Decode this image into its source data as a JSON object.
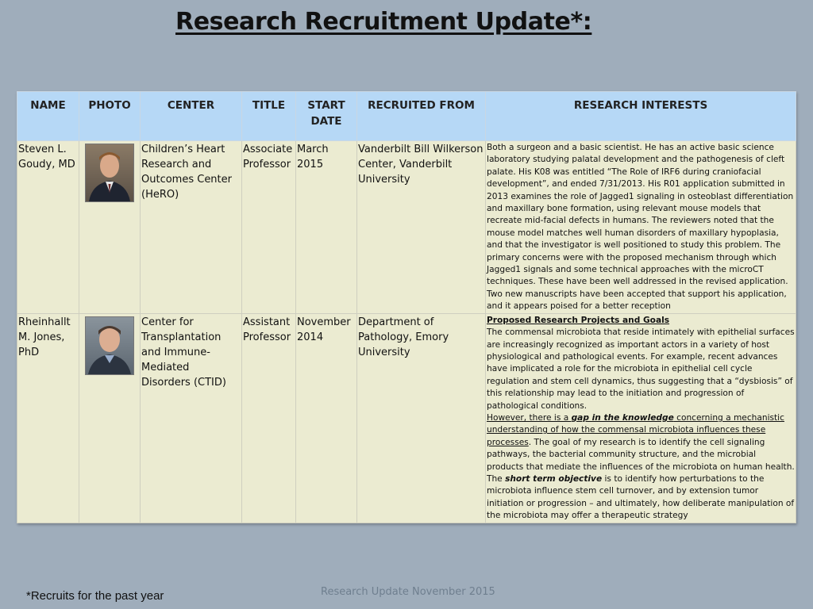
{
  "title": "Research Recruitment Update*:",
  "table": {
    "headers": {
      "name": "NAME",
      "photo": "PHOTO",
      "center": "CENTER",
      "title": "TITLE",
      "start_date": "START DATE",
      "recruited_from": "RECRUITED FROM",
      "research_interests": "RESEARCH INTERESTS"
    },
    "rows": [
      {
        "name": "Steven L. Goudy, MD",
        "center": "Children’s Heart Research and Outcomes Center (HeRO)",
        "title": "Associate Professor",
        "start_date": "March 2015",
        "recruited_from": "Vanderbilt Bill Wilkerson Center, Vanderbilt University",
        "interests": "Both a surgeon and a basic scientist. He has an active basic science laboratory studying palatal development and the pathogenesis of cleft palate. His K08 was entitled “The Role of IRF6 during craniofacial development”, and ended 7/31/2013. His R01 application submitted in 2013 examines the role of Jagged1 signaling in osteoblast differentiation and maxillary bone formation, using relevant mouse models that recreate mid-facial defects in humans. The reviewers noted that the mouse model matches well human disorders of maxillary hypoplasia, and that the investigator is well positioned to study this problem. The primary concerns were with the proposed mechanism through which Jagged1 signals and some technical approaches with the microCT techniques. These have been well addressed in the revised application. Two new manuscripts have been accepted that support his application, and it appears poised for a better reception"
      },
      {
        "name": "Rheinhallt M. Jones, PhD",
        "center": "Center for Transplantation and Immune-Mediated Disorders (CTID)",
        "title": "Assistant Professor",
        "start_date": "November 2014",
        "recruited_from": "Department of Pathology, Emory University",
        "interests": {
          "heading": "Proposed Research Projects and Goals",
          "p1": "The commensal microbiota that reside intimately with epithelial surfaces are increasingly recognized as important actors in a variety of host physiological and pathological events. For example, recent advances have implicated a role for the microbiota in epithelial cell cycle regulation and stem cell dynamics, thus suggesting that a “dysbiosis” of this relationship may lead to the initiation and progression of pathological conditions.",
          "gap_pre": "However, there is a ",
          "gap_em": "gap in the knowledge",
          "gap_post": " concerning a mechanistic understanding of how the commensal microbiota influences these processes",
          "p2": ". The goal of my research is to identify the cell signaling pathways, the bacterial community structure, and the microbial products that mediate the influences of the microbiota on human health. The ",
          "short_term": "short term objective",
          "p3": " is to identify how perturbations to the microbiota influence stem cell turnover, and by extension tumor initiation or progression – and ultimately, how deliberate manipulation of the microbiota may offer a therapeutic strategy"
        }
      }
    ]
  },
  "footnote": "*Recruits for the past year",
  "footer": "Research Update November 2015"
}
